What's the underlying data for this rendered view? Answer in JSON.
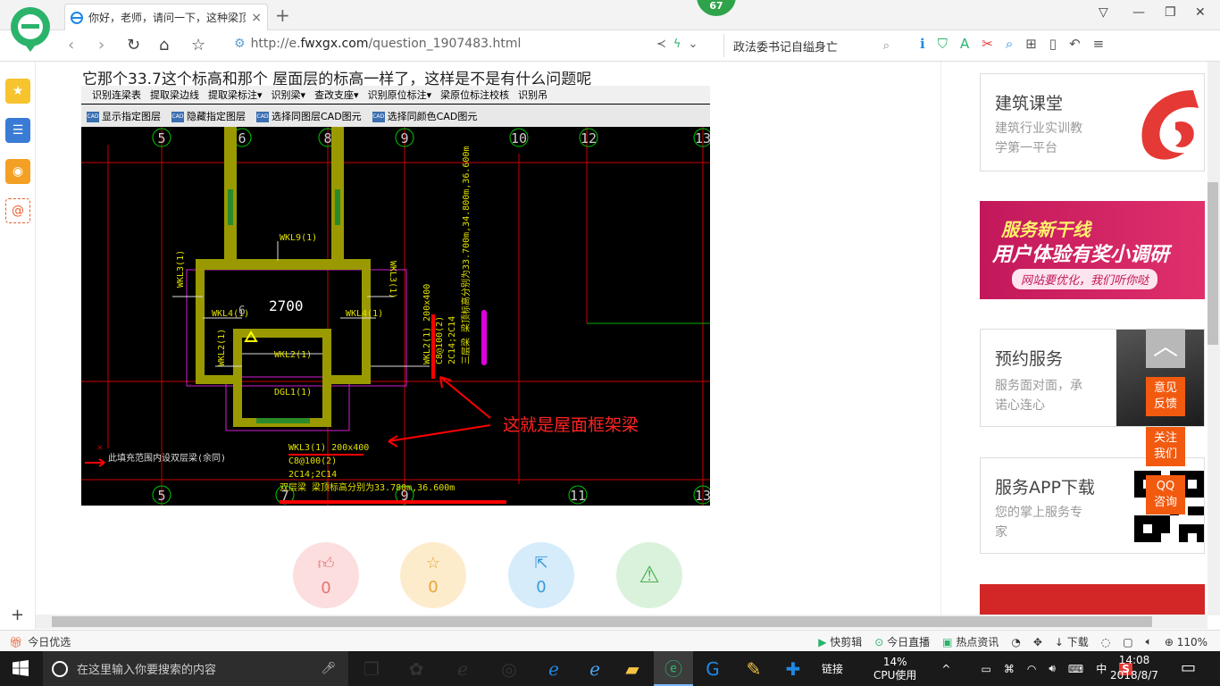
{
  "browser": {
    "tab_title": "你好，老师，请问一下，这种梁顶",
    "tab_close": "×",
    "new_tab": "+",
    "update_badge": "67",
    "url_prefix": "http://e.",
    "url_domain": "fwxgx.com",
    "url_path": "/question_1907483.html",
    "search_text": "政法委书记自缢身亡",
    "window_controls": [
      "restore-down-icon",
      "minimize-icon",
      "maximize-icon",
      "close-icon"
    ]
  },
  "sidebar": {
    "items": [
      {
        "icon": "favorites-star-icon",
        "color": "#f7c32e"
      },
      {
        "icon": "reading-list-icon",
        "color": "#3a7bd5"
      },
      {
        "icon": "weibo-icon",
        "color": "#e6162d"
      },
      {
        "icon": "email-icon",
        "color": "#e85d2c"
      }
    ],
    "add": "+"
  },
  "question": {
    "text": "它那个33.7这个标高和那个 屋面层的标高一样了，这样是不是有什么问题呢"
  },
  "cad_toolbar": {
    "row1": [
      "识别连梁表",
      "提取梁边线",
      "提取梁标注▾",
      "识别梁▾",
      "查改支座▾",
      "识别原位标注▾",
      "梁原位标注校核",
      "识别吊"
    ],
    "row2": [
      "显示指定图层",
      "隐藏指定图层",
      "选择同图层CAD图元",
      "选择同颜色CAD图元"
    ]
  },
  "cad": {
    "axis_top": [
      "5",
      "6",
      "8",
      "9",
      "10",
      "12",
      "13"
    ],
    "axis_bottom": [
      "5",
      "7",
      "9",
      "11",
      "13"
    ],
    "beam_labels": [
      "WKL9(1)",
      "WKL3(1)",
      "WKL3(1)",
      "WKL4(1)",
      "WKL4(1)",
      "WKL2(1)",
      "WKL2(1)",
      "DGL1(1)",
      "WKL2(1) 200x400"
    ],
    "dimension": "2700",
    "axis6": "6",
    "wkl2_spec": [
      "C8@100(2)",
      "2C14;2C14",
      "三层梁 梁顶标高分别为33.700m,34.800m,36.600m"
    ],
    "wkl3_spec": [
      "WKL3(1) 200x400",
      "C8@100(2)",
      "2C14;2C14",
      "双层梁 梁顶标高分别为33.780m,36.600m"
    ],
    "left_note": "此填充范围内设双层梁(余同)",
    "annotation": "这就是屋面框架梁"
  },
  "actions": [
    {
      "name": "like",
      "icon": "thumbs-up-icon",
      "count": "0",
      "bg": "#fcdede",
      "fg": "#e57373"
    },
    {
      "name": "favorite",
      "icon": "star-icon",
      "count": "0",
      "bg": "#fdeccc",
      "fg": "#e8a33a"
    },
    {
      "name": "share",
      "icon": "share-icon",
      "count": "0",
      "bg": "#d6ecfb",
      "fg": "#3a9ad9"
    },
    {
      "name": "report",
      "icon": "warning-icon",
      "count": "",
      "bg": "#daf2dc",
      "fg": "#4caf50"
    }
  ],
  "right": {
    "card1": {
      "title": "建筑课堂",
      "desc1": "建筑行业实训教",
      "desc2": "学第一平台"
    },
    "ad1": {
      "line1": "服务新干线",
      "line2": "用户体验有奖小调研",
      "line3": "网站要优化，我们听你哒"
    },
    "card2": {
      "title": "预约服务",
      "desc1": "服务面对面，承",
      "desc2": "诺心连心"
    },
    "card3": {
      "title": "服务APP下载",
      "desc1": "您的掌上服务专",
      "desc2": "家"
    },
    "float_buttons": [
      "意见\n反馈",
      "关注\n我们",
      "QQ\n咨询"
    ],
    "to_top": "︿"
  },
  "statusbar": {
    "left": "今日优选",
    "items": [
      "快剪辑",
      "今日直播",
      "热点资讯",
      "下载"
    ],
    "zoom": "110%"
  },
  "taskbar": {
    "search_placeholder": "在这里输入你要搜索的内容",
    "link_label": "链接",
    "cpu_percent": "14%",
    "cpu_label": "CPU使用",
    "ime": "中",
    "time": "14:08",
    "date": "2018/8/7"
  }
}
